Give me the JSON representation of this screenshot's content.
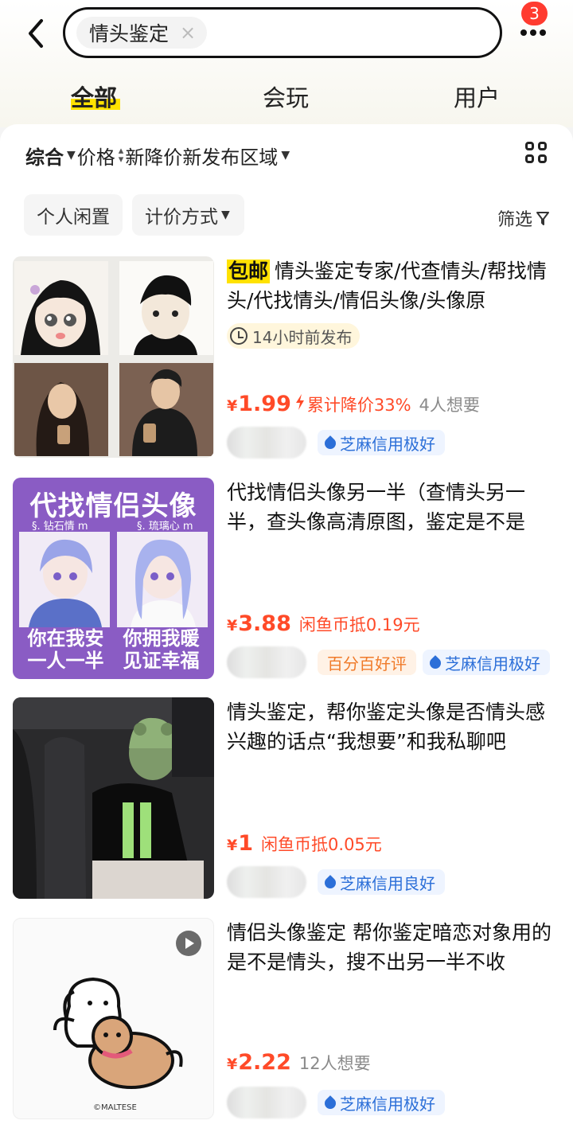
{
  "search": {
    "query": "情头鉴定",
    "clear": "×"
  },
  "notification_count": "3",
  "tabs": [
    {
      "label": "全部"
    },
    {
      "label": "会玩"
    },
    {
      "label": "用户"
    }
  ],
  "sortbar": {
    "items": [
      {
        "label": "综合"
      },
      {
        "label": "价格"
      },
      {
        "label": "新降价"
      },
      {
        "label": "新发布"
      },
      {
        "label": "区域"
      }
    ]
  },
  "filters": [
    {
      "label": "个人闲置"
    },
    {
      "label": "计价方式"
    }
  ],
  "filter_right": "筛选",
  "items": [
    {
      "badge": "包邮",
      "title": "情头鉴定专家/代查情头/帮找情头/代找情头/情侣头像/头像原",
      "time": "14小时前发布",
      "price": "1.99",
      "price_note": "累计降价33%",
      "wants": "4人想要",
      "credit": "芝麻信用极好"
    },
    {
      "title": "代找情侣头像另一半（查情头另一半，查头像高清原图，鉴定是不是",
      "price": "3.88",
      "price_note": "闲鱼币抵0.19元",
      "rating": "百分百好评",
      "credit": "芝麻信用极好",
      "thumb": {
        "headline": "代找情侣头像",
        "sub_left": "§. 钻石情 m",
        "sub_right": "§. 琉璃心 m",
        "bottom_l1": "你在我安",
        "bottom_l2": "一人一半",
        "bottom_r1": "你拥我暖",
        "bottom_r2": "见证幸福"
      }
    },
    {
      "title": "情头鉴定，帮你鉴定头像是否情头感兴趣的话点“我想要”和我私聊吧",
      "price": "1",
      "price_note": "闲鱼币抵0.05元",
      "credit": "芝麻信用良好"
    },
    {
      "title": "情侣头像鉴定 帮你鉴定暗恋对象用的是不是情头，搜不出另一半不收",
      "price": "2.22",
      "wants": "12人想要",
      "credit": "芝麻信用极好",
      "thumb": {
        "watermark": "©MALTESE"
      }
    }
  ],
  "currency": "¥",
  "colors": {
    "accent": "#ffe200",
    "price": "#ff4a28",
    "credit": "#2c6fd8",
    "rating": "#f07b2a"
  },
  "icons": [
    "back-icon",
    "more-icon",
    "grid-view-icon",
    "filter-icon",
    "clock-icon",
    "credit-drop-icon",
    "play-icon",
    "chevron-down-icon",
    "sort-arrows-icon"
  ]
}
